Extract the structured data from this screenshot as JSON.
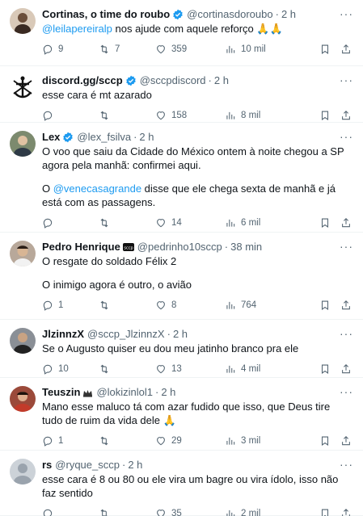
{
  "tweets": [
    {
      "name": "Cortinas, o time do roubo",
      "verified": true,
      "handle": "@cortinasdoroubo",
      "dot": "·",
      "time": "2 h",
      "more": "···",
      "avatar_color": "#d9c9b8",
      "mention": "@leilapereiralp",
      "text": " nos ajude com aquele reforço 🙏🙏",
      "replies": "9",
      "retweets": "7",
      "likes": "359",
      "views": "10 mil"
    },
    {
      "name": "discord.gg/sccp",
      "verified": true,
      "handle": "@sccpdiscord",
      "dot": "·",
      "time": "2 h",
      "more": "···",
      "avatar_color": "#ffffff",
      "text": "esse cara é mt azarado",
      "replies": "",
      "retweets": "",
      "likes": "158",
      "views": "8 mil"
    },
    {
      "name": "Lex",
      "verified": true,
      "handle": "@lex_fsilva",
      "dot": "·",
      "time": "2 h",
      "more": "···",
      "avatar_color": "#7c8a6e",
      "text_p1": "O voo que saiu da Cidade do México ontem à noite chegou a SP agora pela manhã: confirmei aqui.",
      "text_p2_prefix": "O ",
      "mention": "@venecasagrande",
      "text_p2_suffix": " disse que ele chega sexta de manhã e já está com as passagens.",
      "replies": "",
      "retweets": "",
      "likes": "14",
      "views": "6 mil"
    },
    {
      "name": "Pedro Henrique",
      "sccp_badge": "sccp",
      "handle": "@pedrinho10sccp",
      "dot": "·",
      "time": "38 min",
      "more": "···",
      "avatar_color": "#b8a89a",
      "text_p1": "O resgate do soldado Félix 2",
      "text_p2": "O inimigo agora é outro, o avião",
      "replies": "1",
      "retweets": "",
      "likes": "8",
      "views": "764"
    },
    {
      "name": "JlzinnzX",
      "handle": "@sccp_JlzinnzX",
      "dot": "·",
      "time": "2 h",
      "more": "···",
      "avatar_color": "#8a8f96",
      "text": "Se o Augusto quiser eu dou meu jatinho branco pra ele",
      "replies": "10",
      "retweets": "",
      "likes": "13",
      "views": "4 mil"
    },
    {
      "name": "Teuszin",
      "handle": "@lokizinlol1",
      "dot": "·",
      "time": "2 h",
      "more": "···",
      "avatar_color": "#9b4a3a",
      "text": "Mano esse maluco tá com azar fudido que isso, que Deus tire tudo de ruim da vida dele 🙏",
      "replies": "1",
      "retweets": "",
      "likes": "29",
      "views": "3 mil"
    },
    {
      "name": "rs",
      "handle": "@ryque_sccp",
      "dot": "·",
      "time": "2 h",
      "more": "···",
      "avatar_color": "#ccd2d8",
      "text": "esse cara é 8 ou 80 ou ele vira um bagre ou vira ídolo, isso não faz sentido",
      "replies": "",
      "retweets": "",
      "likes": "35",
      "views": "2 mil"
    }
  ],
  "colors": {
    "accent": "#1d9bf0",
    "muted": "#536471",
    "text": "#0f1419",
    "divider": "#eff3f4"
  }
}
